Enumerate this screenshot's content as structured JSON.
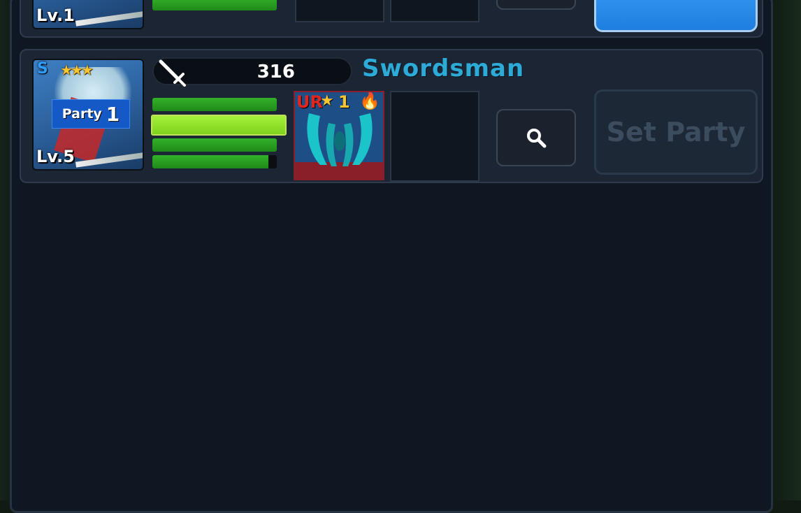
{
  "top_card": {
    "level": "Lv.1",
    "bars": [
      1.0,
      1.0
    ]
  },
  "hero": {
    "grade": "S",
    "stars": "★★★",
    "party_label": "Party",
    "party_number": "1",
    "level": "Lv.5",
    "power": "316",
    "name": "Swordsman",
    "bars": [
      1.0,
      1.0,
      1.0,
      0.93
    ]
  },
  "equipment": {
    "rarity": "UR",
    "star": "★",
    "star_level": "1",
    "icon": "claw-icon"
  },
  "buttons": {
    "search_icon": "magnifier-icon",
    "set_party_label": "Set Party"
  },
  "colors": {
    "name": "#2eaad6",
    "bar_green": "#34b02a",
    "bar_highlight": "#a6f03c",
    "set_party_active": "#1f7ee0",
    "rarity_ur": "#e0261f"
  }
}
